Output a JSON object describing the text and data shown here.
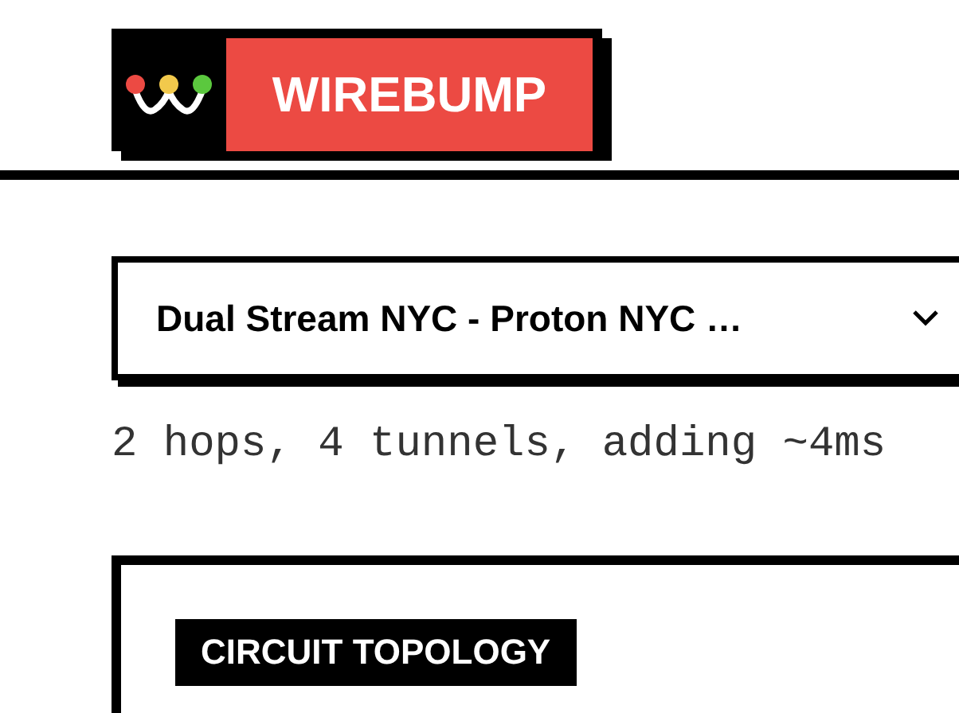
{
  "logo": {
    "name": "WIREBUMP"
  },
  "route_select": {
    "value": "Dual Stream NYC - Proton NYC …"
  },
  "route_summary": "2 hops, 4 tunnels, adding ~4ms",
  "card": {
    "label": "CIRCUIT TOPOLOGY"
  }
}
